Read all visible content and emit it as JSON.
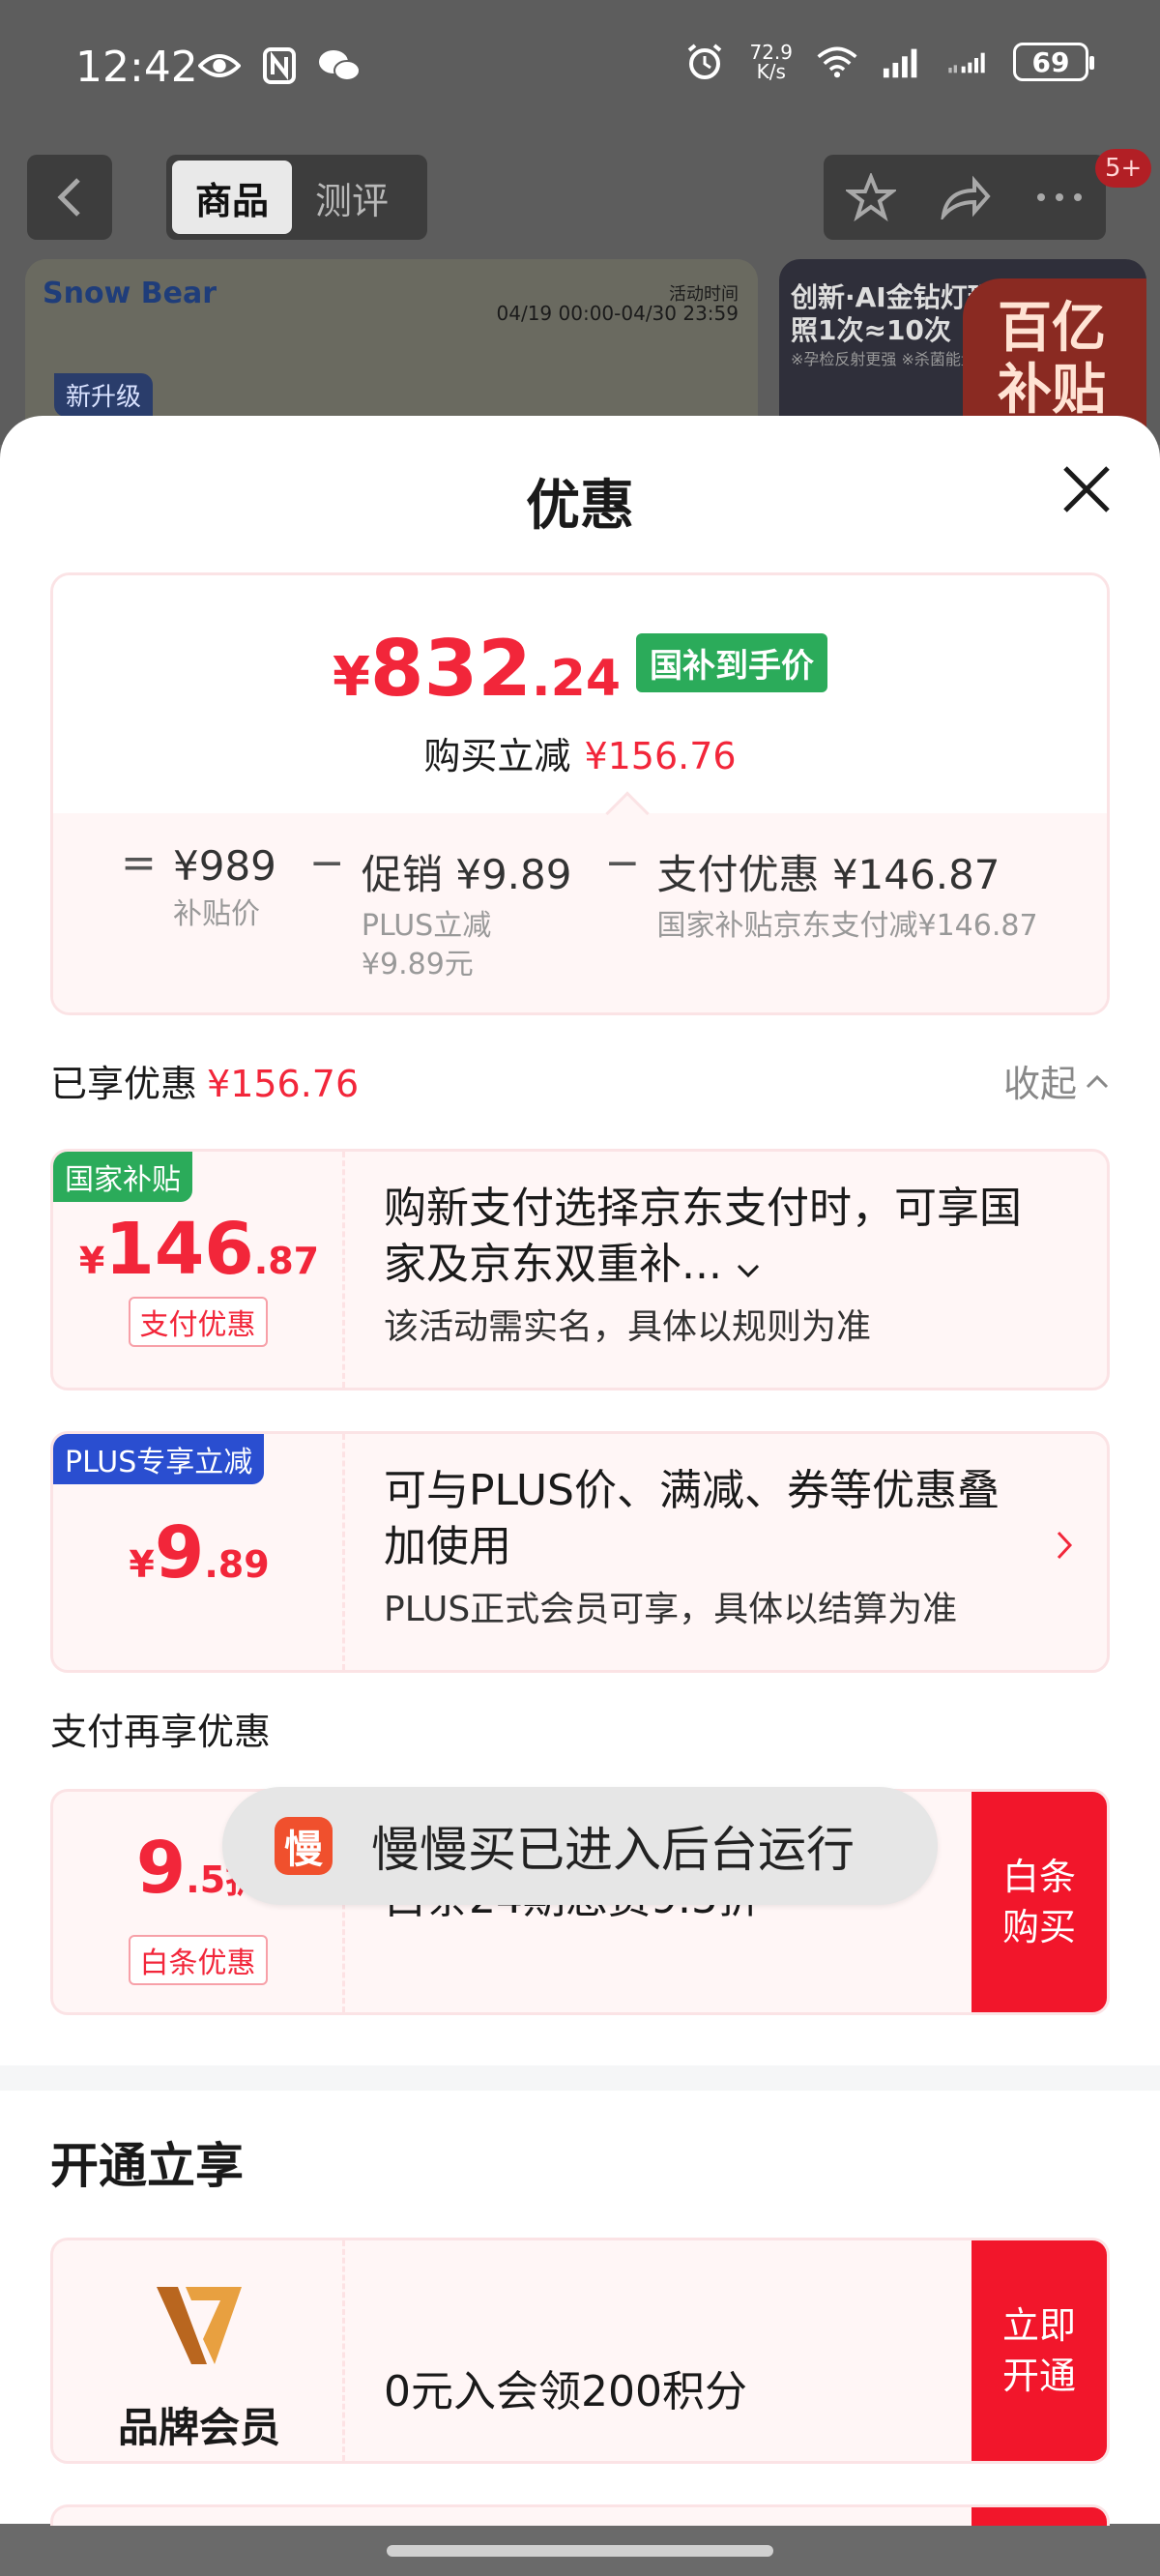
{
  "status_bar": {
    "time": "12:42",
    "speed_value": "72.9",
    "speed_unit": "K/s",
    "battery": "69"
  },
  "nav": {
    "tabs": [
      "商品",
      "测评"
    ],
    "badge": "5+"
  },
  "banner_left": {
    "brand": "Snow Bear",
    "time_label": "活动时间",
    "time": "04/19 00:00-04/30 23:59",
    "tag": "新升级"
  },
  "banner_right": {
    "line1": "创新·AI金钻灯珠",
    "line2": "照1次≈10次",
    "small": "※孕检反射更强  ※杀菌能量更强",
    "badge": "百亿\n补贴"
  },
  "sheet": {
    "title": "优惠",
    "summary": {
      "price_symbol": "¥",
      "price_int": "832",
      "price_dec": ".24",
      "price_tag": "国补到手价",
      "reduce_label": "购买立减",
      "reduce_value": "¥156.76",
      "eq": "=",
      "minus": "−",
      "items": [
        {
          "main": "¥989",
          "sub": "补贴价"
        },
        {
          "main": "促销 ¥9.89",
          "sub": "PLUS立减\n¥9.89元"
        },
        {
          "main": "支付优惠 ¥146.87",
          "sub": "国家补贴京东支付减¥146.87"
        }
      ]
    },
    "enjoyed_label": "已享优惠",
    "enjoyed_value": "¥156.76",
    "collapse_label": "收起",
    "deals": [
      {
        "tag": "国家补贴",
        "symbol": "¥",
        "int": "146",
        "dec": ".87",
        "chip": "支付优惠",
        "title": "购新支付选择京东支付时，可享国家及京东双重补...",
        "sub": "该活动需实名，具体以规则为准"
      },
      {
        "tag": "PLUS专享立减",
        "symbol": "¥",
        "int": "9",
        "dec": ".89",
        "title": "可与PLUS价、满减、券等优惠叠加使用",
        "sub": "PLUS正式会员可享，具体以结算为准"
      }
    ],
    "pay_section_label": "支付再享优惠",
    "pay_deal": {
      "int": "9",
      "dec": ".5折",
      "chip": "白条优惠",
      "title": "白条24期息费9.5折",
      "action": "白条\n购买"
    },
    "open_title": "开通立享",
    "brand_deal": {
      "name": "品牌会员",
      "title": "0元入会领200积分",
      "action": "立即\n开通"
    }
  },
  "toast": {
    "icon": "慢",
    "text": "慢慢买已进入后台运行"
  }
}
